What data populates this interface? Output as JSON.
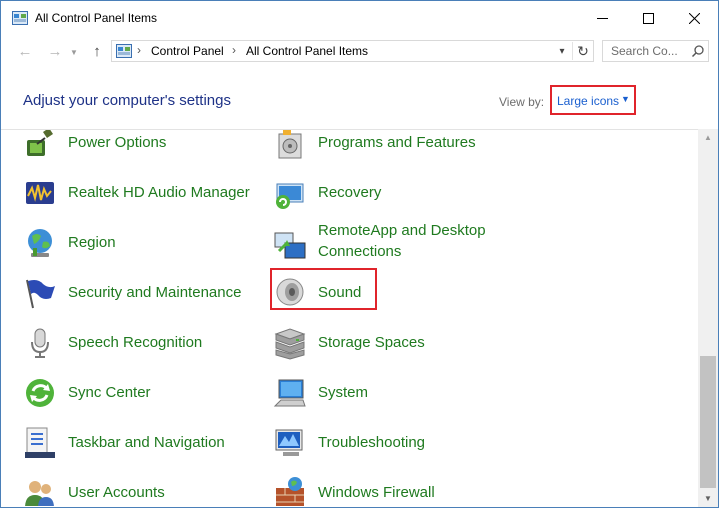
{
  "window": {
    "title": "All Control Panel Items",
    "controls": {
      "minimize": "—",
      "maximize": "☐",
      "close": "✕"
    }
  },
  "nav": {
    "back": "←",
    "forward": "→",
    "up": "↑",
    "breadcrumb": [
      "Control Panel",
      "All Control Panel Items"
    ],
    "separator": "›",
    "dropdown": "⌄",
    "refresh": "↻",
    "search_placeholder": "Search Co..."
  },
  "header": {
    "heading": "Adjust your computer's settings",
    "view_by_label": "View by:",
    "view_by_value": "Large icons",
    "view_by_caret": "▼"
  },
  "items": [
    {
      "label": "Power Options",
      "icon": "power-options-icon"
    },
    {
      "label": "Programs and Features",
      "icon": "programs-features-icon"
    },
    {
      "label": "Realtek HD Audio Manager",
      "icon": "realtek-audio-icon"
    },
    {
      "label": "Recovery",
      "icon": "recovery-icon"
    },
    {
      "label": "Region",
      "icon": "region-globe-icon"
    },
    {
      "label": "RemoteApp and Desktop",
      "label2": "Connections",
      "icon": "remoteapp-icon"
    },
    {
      "label": "Security and Maintenance",
      "icon": "security-flag-icon"
    },
    {
      "label": "Sound",
      "icon": "speaker-icon"
    },
    {
      "label": "Speech Recognition",
      "icon": "microphone-icon"
    },
    {
      "label": "Storage Spaces",
      "icon": "storage-spaces-icon"
    },
    {
      "label": "Sync Center",
      "icon": "sync-center-icon"
    },
    {
      "label": "System",
      "icon": "system-monitor-icon"
    },
    {
      "label": "Taskbar and Navigation",
      "icon": "taskbar-icon"
    },
    {
      "label": "Troubleshooting",
      "icon": "troubleshooting-icon"
    },
    {
      "label": "User Accounts",
      "icon": "user-accounts-icon"
    },
    {
      "label": "Windows Firewall",
      "icon": "firewall-icon"
    }
  ],
  "scrollbar": {
    "up": "▲",
    "down": "▼"
  },
  "colors": {
    "link_green": "#1f7a1f",
    "heading_blue": "#1e3287",
    "highlight_red": "#e0242b",
    "view_blue": "#1a5fcf"
  }
}
